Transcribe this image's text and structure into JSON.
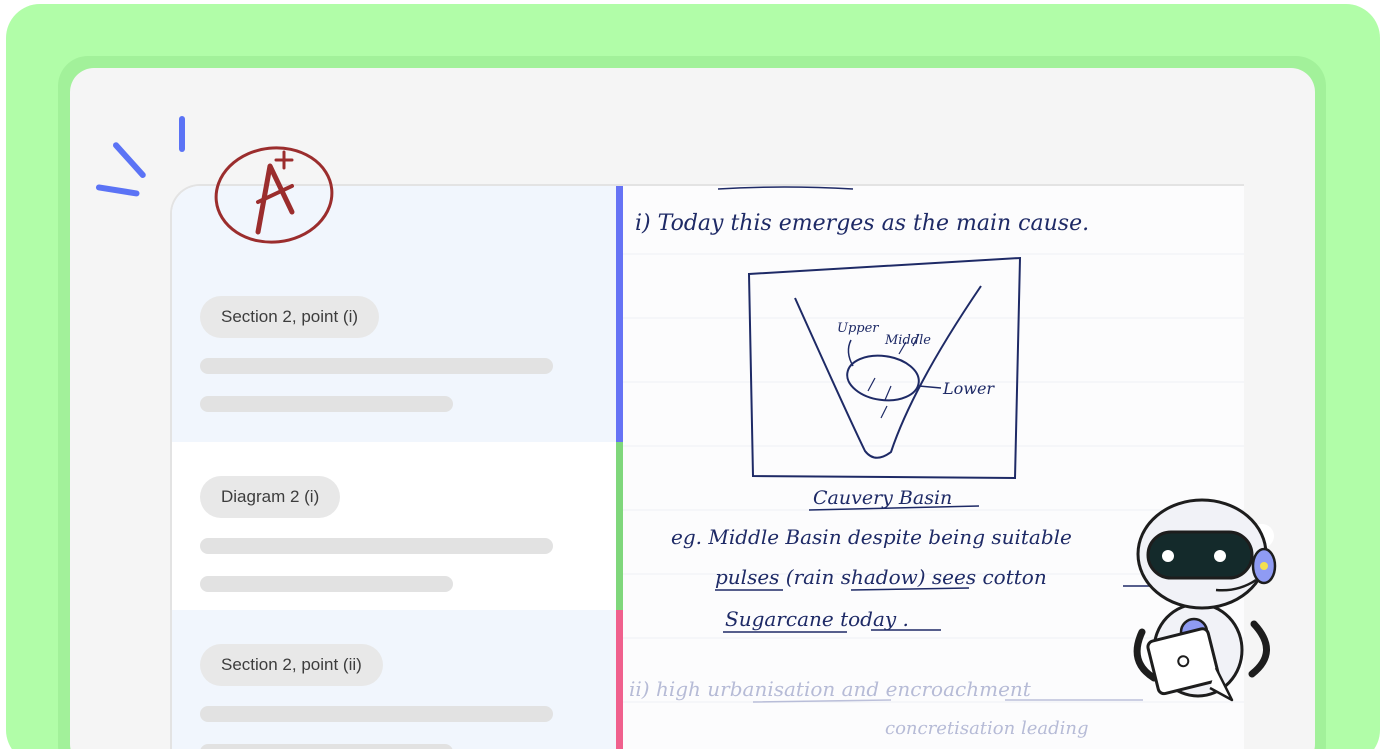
{
  "grade": {
    "letter": "A",
    "modifier": "+"
  },
  "sidebar": {
    "items": [
      {
        "label": "Section 2, point (i)"
      },
      {
        "label": "Diagram 2 (i)"
      },
      {
        "label": "Section 2, point (ii)"
      }
    ]
  },
  "strip_colors": [
    "#6673f5",
    "#7fd77b",
    "#f0608d"
  ],
  "answer_sheet": {
    "line_top": "i)   Today   this   emerges  as  the   main   cause.",
    "diagram_labels": {
      "upper": "Upper",
      "middle": "Middle",
      "lower": "Lower",
      "caption": "Cauvery Basin"
    },
    "line_eg": "eg.  Middle  Basin  despite  being  suitable",
    "line_pulses": "pulses (rain shadow)  sees  cotton",
    "line_sugarcane": "Sugarcane  today .",
    "line_ii": "ii)  high  urbanisation   and   encroachment",
    "line_ii_cont": "concretisation  leading"
  }
}
